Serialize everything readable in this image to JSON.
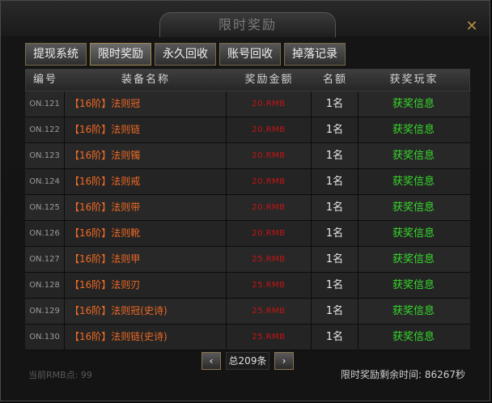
{
  "window": {
    "title": "限时奖励",
    "close_label": "✕"
  },
  "tabs": [
    {
      "label": "提现系统"
    },
    {
      "label": "限时奖励"
    },
    {
      "label": "永久回收"
    },
    {
      "label": "账号回收"
    },
    {
      "label": "掉落记录"
    }
  ],
  "table": {
    "headers": [
      "编号",
      "装备名称",
      "奖励金额",
      "名额",
      "获奖玩家"
    ],
    "rows": [
      {
        "id": "ON.121",
        "name": "【16阶】法则冠",
        "reward": "20.RMB",
        "quota": "1名",
        "winner": "获奖信息"
      },
      {
        "id": "ON.122",
        "name": "【16阶】法则链",
        "reward": "20.RMB",
        "quota": "1名",
        "winner": "获奖信息"
      },
      {
        "id": "ON.123",
        "name": "【16阶】法则镯",
        "reward": "20.RMB",
        "quota": "1名",
        "winner": "获奖信息"
      },
      {
        "id": "ON.124",
        "name": "【16阶】法则戒",
        "reward": "20.RMB",
        "quota": "1名",
        "winner": "获奖信息"
      },
      {
        "id": "ON.125",
        "name": "【16阶】法则带",
        "reward": "20.RMB",
        "quota": "1名",
        "winner": "获奖信息"
      },
      {
        "id": "ON.126",
        "name": "【16阶】法则靴",
        "reward": "20.RMB",
        "quota": "1名",
        "winner": "获奖信息"
      },
      {
        "id": "ON.127",
        "name": "【16阶】法则甲",
        "reward": "25.RMB",
        "quota": "1名",
        "winner": "获奖信息"
      },
      {
        "id": "ON.128",
        "name": "【16阶】法则刃",
        "reward": "25.RMB",
        "quota": "1名",
        "winner": "获奖信息"
      },
      {
        "id": "ON.129",
        "name": "【16阶】法则冠(史诗)",
        "reward": "25.RMB",
        "quota": "1名",
        "winner": "获奖信息"
      },
      {
        "id": "ON.130",
        "name": "【16阶】法则链(史诗)",
        "reward": "25.RMB",
        "quota": "1名",
        "winner": "获奖信息"
      }
    ]
  },
  "pager": {
    "prev_icon": "‹",
    "next_icon": "›",
    "total_text": "总209条"
  },
  "footer": {
    "current_points": "当前RMB点: 99",
    "remaining_time": "限时奖励剩余时间: 86267秒"
  },
  "colors": {
    "item_name": "#f06a24",
    "reward": "#c81414",
    "winner_link": "#37d82c",
    "tab_border": "#7a6a48"
  },
  "icons": {
    "close": "close-icon",
    "prev": "chevron-left-icon",
    "next": "chevron-right-icon"
  }
}
